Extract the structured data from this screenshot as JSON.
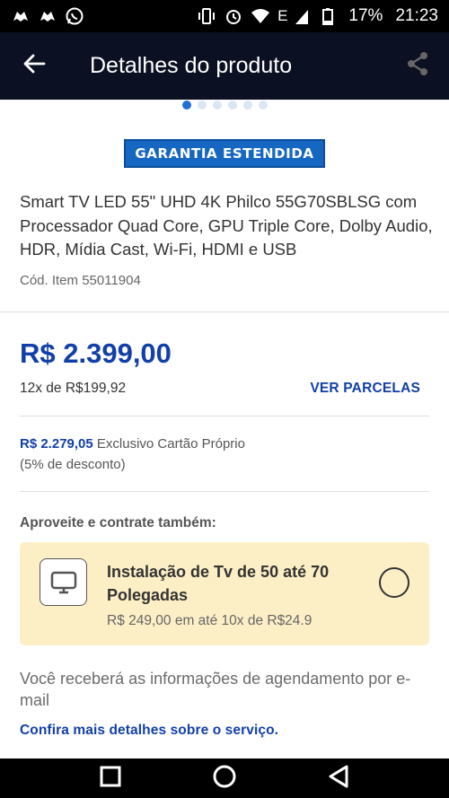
{
  "status_bar": {
    "battery": "17%",
    "time": "21:23",
    "left_icons": [
      "game-pad-icon",
      "game-pad-icon",
      "whatsapp-icon"
    ],
    "right_icons": [
      "vibrate-icon",
      "alarm-icon",
      "wifi-icon",
      "signal-e-icon",
      "battery-icon"
    ],
    "network_letter": "E"
  },
  "app_bar": {
    "title": "Detalhes do produto",
    "back_icon": "arrow-back-icon",
    "share_icon": "share-icon"
  },
  "carousel": {
    "total": 6,
    "active_index": 0
  },
  "badge": {
    "label": "GARANTIA ESTENDIDA"
  },
  "product": {
    "title": "Smart TV LED 55\" UHD 4K Philco 55G70SBLSG com Processador Quad Core, GPU Triple Core, Dolby Audio, HDR, Mídia Cast, Wi-Fi, HDMI e USB",
    "code": "Cód. Item 55011904"
  },
  "pricing": {
    "price": "R$ 2.399,00",
    "installments": "12x de R$199,92",
    "ver_parcelas": "VER PARCELAS",
    "card_amount": "R$ 2.279,05",
    "card_label": " Exclusivo Cartão Próprio",
    "card_discount": "(5% de desconto)"
  },
  "services": {
    "section_label": "Aproveite e contrate também:",
    "item": {
      "icon": "tv-icon",
      "title": "Instalação de Tv de 50 até 70 Polegadas",
      "price": "R$ 249,00 em até 10x de R$24.9",
      "selected": false
    },
    "info": "Você receberá as informações de agendamento por e-mail",
    "link": "Confira mais detalhes sobre o serviço."
  },
  "nav_bar": {
    "icons": [
      "recent-apps-icon",
      "home-icon",
      "back-icon"
    ]
  },
  "colors": {
    "app_bar_bg": "#0b1122",
    "price_blue": "#1240a8",
    "badge_blue": "#1667c2",
    "service_bg": "#fdefc5"
  }
}
